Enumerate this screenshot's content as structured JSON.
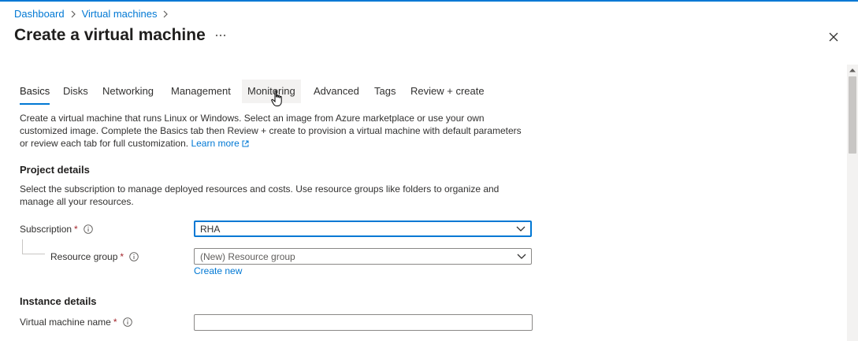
{
  "breadcrumb": {
    "items": [
      "Dashboard",
      "Virtual machines"
    ]
  },
  "page": {
    "title": "Create a virtual machine"
  },
  "tabs": [
    "Basics",
    "Disks",
    "Networking",
    "Management",
    "Monitoring",
    "Advanced",
    "Tags",
    "Review + create"
  ],
  "active_tab": "Basics",
  "hovered_tab": "Monitoring",
  "intro": {
    "text": "Create a virtual machine that runs Linux or Windows. Select an image from Azure marketplace or use your own customized image. Complete the Basics tab then Review + create to provision a virtual machine with default parameters or review each tab for full customization.",
    "learn_more": "Learn more"
  },
  "project_details": {
    "title": "Project details",
    "description": "Select the subscription to manage deployed resources and costs. Use resource groups like folders to organize and manage all your resources.",
    "subscription_label": "Subscription",
    "subscription_value": "RHA",
    "resource_group_label": "Resource group",
    "resource_group_value": "(New) Resource group",
    "create_new": "Create new"
  },
  "instance_details": {
    "title": "Instance details",
    "vm_name_label": "Virtual machine name",
    "vm_name_value": ""
  },
  "required_marker": "*",
  "colors": {
    "accent": "#0078d4",
    "required": "#a4262c",
    "text": "#323130"
  },
  "icons": [
    "chevron-right-icon",
    "more-icon",
    "close-icon",
    "info-icon",
    "chevron-down-icon",
    "external-link-icon",
    "hand-cursor-icon"
  ]
}
